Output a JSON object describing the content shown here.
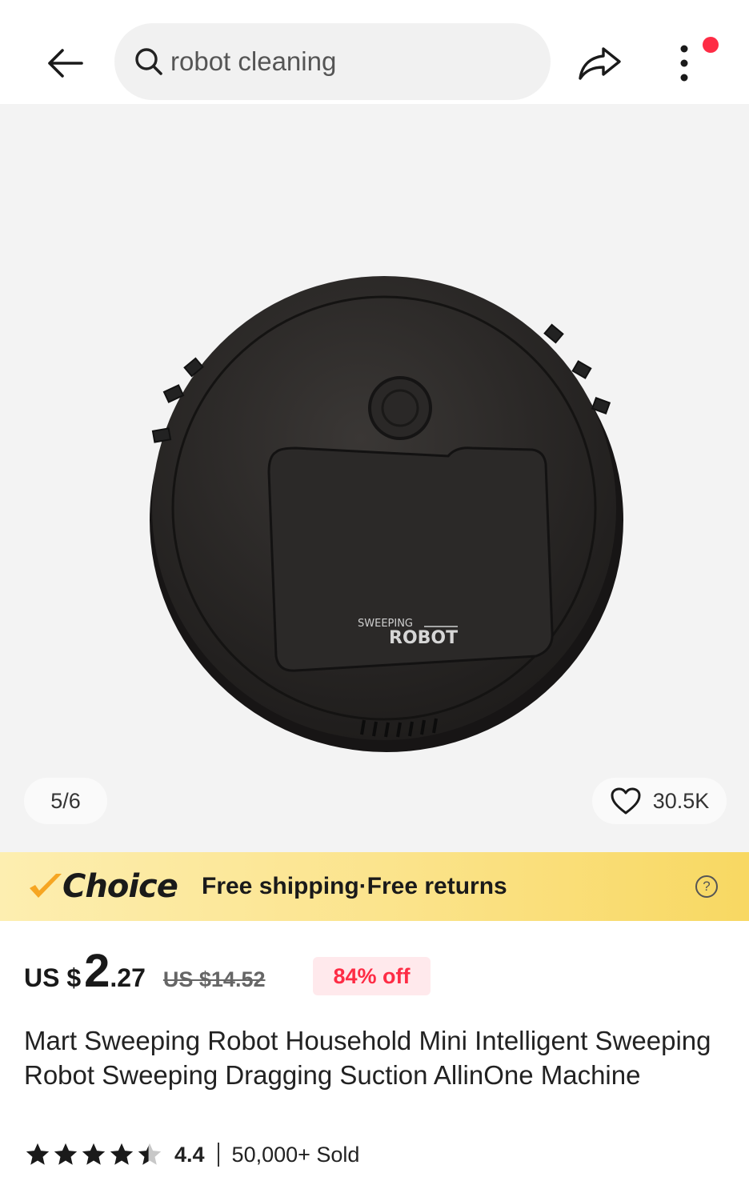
{
  "header": {
    "search_query": "robot cleaning",
    "icons": [
      "back-arrow-icon",
      "search-icon",
      "share-icon",
      "more-vertical-icon"
    ],
    "notification_dot_color": "#fe2c45"
  },
  "gallery": {
    "image_counter": "5/6",
    "likes": "30.5K",
    "product_label_small": "SWEEPING",
    "product_label_large": "ROBOT"
  },
  "choice_banner": {
    "brand": "Choice",
    "text": "Free shipping·Free returns",
    "help_icon": "?"
  },
  "price": {
    "currency_prefix": "US $",
    "integer": "2",
    "decimal": ".27",
    "original": "US $14.52",
    "discount": "84% off",
    "accent_color": "#fe2c45"
  },
  "product": {
    "title": "Mart Sweeping Robot Household Mini Intelligent Sweeping Robot Sweeping Dragging Suction AllinOne Machine",
    "rating": 4.4,
    "rating_text": "4.4",
    "sold": "50,000+ Sold"
  }
}
